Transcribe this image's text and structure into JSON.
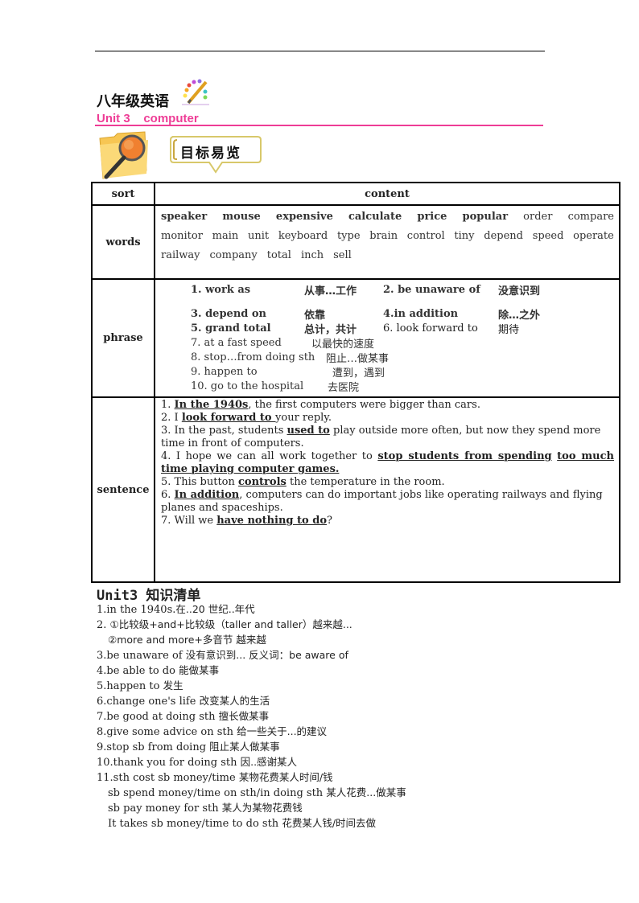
{
  "header": {
    "grade_title": "八年级英语",
    "unit_title": "Unit 3    computer",
    "badge_label": "目标易览"
  },
  "table": {
    "header": {
      "sort": "sort",
      "content": "content"
    },
    "words": {
      "label": "words",
      "bold_words": [
        "speaker",
        "mouse",
        "expensive",
        "calculate",
        "price",
        "popular"
      ],
      "line1_plain": [
        "order",
        "compare"
      ],
      "line2": [
        "monitor",
        "main",
        "unit",
        "keyboard",
        "type",
        "brain",
        "control",
        "tiny",
        "depend",
        "speed",
        "operate"
      ],
      "line3": [
        "railway",
        "company",
        "total",
        "inch",
        "sell"
      ]
    },
    "phrase": {
      "label": "phrase",
      "bold_rows": [
        {
          "p1": "1. work as",
          "m1": "从事…工作",
          "p2": "2. be unaware of",
          "m2": "没意识到"
        },
        {
          "p1": "3. depend on",
          "m1": "依靠",
          "p2": "4.in addition",
          "m2": "除…之外"
        },
        {
          "p1": "5. grand total",
          "m1": "总计，共计",
          "p2": "6. look forward to",
          "m2": "期待"
        }
      ],
      "simple_rows": [
        {
          "p": "7. at a fast speed",
          "m": "以最快的速度"
        },
        {
          "p": "8. stop…from doing sth",
          "m": "阻止…做某事"
        },
        {
          "p": "9. happen to",
          "m": "遭到，遇到"
        },
        {
          "p": "10. go to the hospital",
          "m": "去医院"
        }
      ]
    },
    "sentence": {
      "label": "sentence",
      "s1": {
        "pre": "1. ",
        "u": "In the 1940s",
        "post": ", the first computers were bigger than cars."
      },
      "s2": {
        "pre": "2. I ",
        "u": "look forward to ",
        "post": "your reply."
      },
      "s3": {
        "pre": "3. In the past, students ",
        "u": "used to",
        "post": " play outside more often, but now they spend more time in front of computers."
      },
      "s4": {
        "pre": "4. I hope we can all work together to ",
        "u1": "stop students from spending",
        "u2": "too much time playing computer games."
      },
      "s5": {
        "pre": "5. This button ",
        "u": "controls",
        "post": " the temperature in the room."
      },
      "s6": {
        "pre": "6. ",
        "u": "In addition",
        "post": ", computers can do important jobs like operating railways and flying planes and spaceships."
      },
      "s7": {
        "pre": "7. Will we ",
        "u": "have nothing to do",
        "post": "?"
      }
    }
  },
  "knowledge": {
    "title": "Unit3 知识清单",
    "items": [
      {
        "en": "1.in the 1940s.",
        "zh": "在..20 世纪..年代"
      },
      {
        "en": "2. ",
        "zh": "①比较级+and+比较级（taller and taller）越来越..."
      },
      {
        "en": "   ",
        "zh": "②more and more+多音节  越来越",
        "indent": true
      },
      {
        "en": "3.be unaware of ",
        "zh": "没有意识到...     反义词：be aware of"
      },
      {
        "en": "4.be able to do ",
        "zh": "能做某事"
      },
      {
        "en": "5.happen to ",
        "zh": "发生"
      },
      {
        "en": "6.change one's life ",
        "zh": "改变某人的生活"
      },
      {
        "en": "7.be good at doing sth ",
        "zh": "擅长做某事"
      },
      {
        "en": "8.give some advice on sth ",
        "zh": "给一些关于...的建议"
      },
      {
        "en": "9.stop sb from doing ",
        "zh": "阻止某人做某事"
      },
      {
        "en": "10.thank you for doing sth ",
        "zh": "因..感谢某人"
      },
      {
        "en": "11.sth cost sb money/time ",
        "zh": "某物花费某人时间/钱"
      },
      {
        "en": "sb spend money/time on sth/in doing sth ",
        "zh": "某人花费...做某事",
        "indent": true
      },
      {
        "en": "sb pay money for sth ",
        "zh": "某人为某物花费钱",
        "indent": true
      },
      {
        "en": "It takes sb money/time to do sth ",
        "zh": "花费某人钱/时间去做",
        "indent": true
      }
    ]
  },
  "colors": {
    "accent_pink": "#ee3d96"
  }
}
